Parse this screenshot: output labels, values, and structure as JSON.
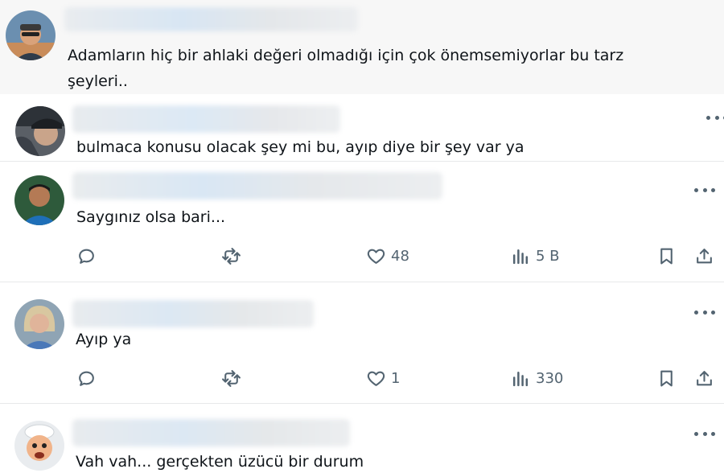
{
  "comments": [
    {
      "text": "Adamların hiç bir ahlaki değeri olmadığı için çok önemsemiyorlar bu tarz",
      "text_line2": "şeyleri..",
      "avatar": "avatar-man-sunglasses"
    },
    {
      "text": "bulmaca konusu olacak şey mi bu, ayıp diye bir şey var ya",
      "avatar": "avatar-man-cap",
      "more": "more-icon"
    },
    {
      "text": "Saygınız olsa bari...",
      "avatar": "avatar-man-blue-shirt",
      "more": "more-icon",
      "likes": "48",
      "views": "5 B"
    },
    {
      "text": "Ayıp ya",
      "avatar": "avatar-woman-blonde",
      "more": "more-icon",
      "likes": "1",
      "views": "330"
    },
    {
      "text": "Vah vah... gerçekten üzücü bir durum",
      "avatar": "avatar-cartoon",
      "more": "more-icon"
    }
  ],
  "icons": {
    "reply": "reply-icon",
    "retweet": "retweet-icon",
    "like": "heart-icon",
    "views": "views-icon",
    "bookmark": "bookmark-icon",
    "share": "share-icon"
  },
  "colors": {
    "text": "#0f1419",
    "muted": "#536471",
    "separator": "#e7e9ea",
    "highlight_bg": "#f7f7f7"
  }
}
